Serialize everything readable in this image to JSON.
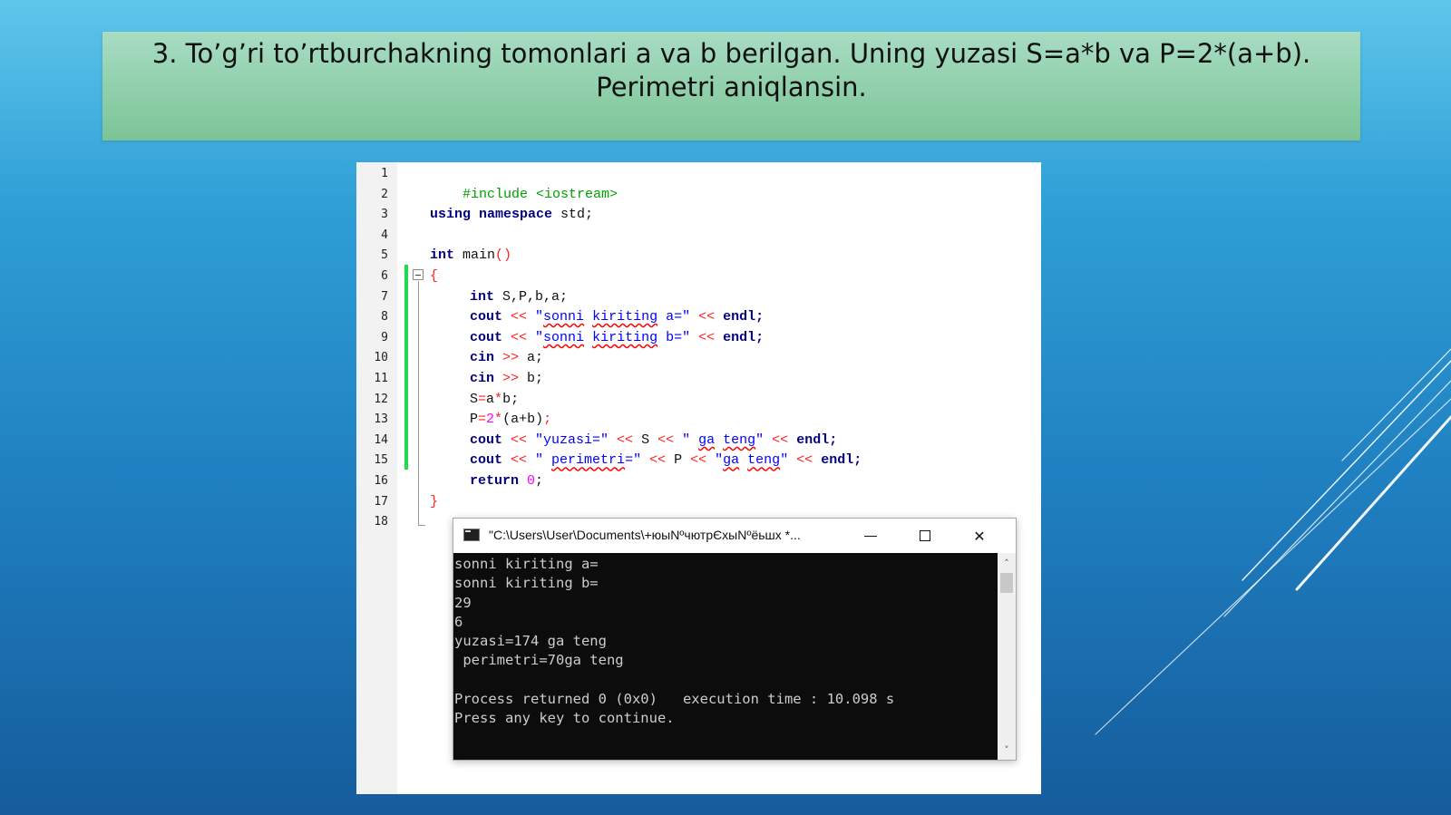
{
  "slide": {
    "title_line1": "3.   To’g’ri to’rtburchakning tomonlari   a va b  berilgan. Uning yuzasi S=a*b  va  P=2*(a+b).",
    "title_line2": "Perimetri aniqlansin."
  },
  "editor": {
    "line_numbers": [
      "1",
      "2",
      "3",
      "4",
      "5",
      "6",
      "7",
      "8",
      "9",
      "10",
      "11",
      "12",
      "13",
      "14",
      "15",
      "16",
      "17",
      "18"
    ],
    "lines": {
      "l1": "#include <iostream>",
      "l3_kw": "using namespace",
      "l3_rest": " std;",
      "l5_kw": "int",
      "l5_rest": " main",
      "l5_paren": "()",
      "l6": "{",
      "l7_kw": "int",
      "l7_rest": " S,P,b,a;",
      "l8_cout": "cout",
      "l8_op1": " << ",
      "l8_q1": "\"",
      "l8_w1": "sonni",
      "l8_sp": " ",
      "l8_w2": "kiriting",
      "l8_tail": " a=\"",
      "l8_op2": " << ",
      "l8_endl": "endl;",
      "l9_cout": "cout",
      "l9_op1": " << ",
      "l9_q1": "\"",
      "l9_w1": "sonni",
      "l9_sp": " ",
      "l9_w2": "kiriting",
      "l9_tail": " b=\"",
      "l9_op2": " << ",
      "l9_endl": "endl;",
      "l10_cin": "cin",
      "l10_op": " >> ",
      "l10_var": "a;",
      "l11_cin": "cin",
      "l11_op": " >> ",
      "l11_var": "b;",
      "l12_a": "S",
      "l12_op1": "=",
      "l12_b": "a",
      "l12_op2": "*",
      "l12_c": "b;",
      "l13_a": "P",
      "l13_op1": "=",
      "l13_num": "2",
      "l13_op2": "*",
      "l13_paren": "(a+b)",
      "l13_semi": ";",
      "l14_cout": "cout",
      "l14_op1": " << ",
      "l14_s1": "\"yuzasi=\"",
      "l14_op2": " << ",
      "l14_var": "S",
      "l14_op3": " << ",
      "l14_q": "\" ",
      "l14_w1": "ga",
      "l14_sp": " ",
      "l14_w2": "teng",
      "l14_q2": "\"",
      "l14_op4": " << ",
      "l14_endl": "endl;",
      "l15_cout": "cout",
      "l15_op1": " << ",
      "l15_q1": "\" ",
      "l15_w1": "perimetri",
      "l15_q2": "=\"",
      "l15_op2": " << ",
      "l15_var": "P",
      "l15_op3": " << ",
      "l15_q3": "\"",
      "l15_w2": "ga",
      "l15_sp": " ",
      "l15_w3": "teng",
      "l15_q4": "\"",
      "l15_op4": " << ",
      "l15_endl": "endl;",
      "l16_kw": "return",
      "l16_sp": " ",
      "l16_num": "0",
      "l16_semi": ";",
      "l17": "}"
    }
  },
  "console": {
    "title": "\"C:\\Users\\User\\Documents\\+юыNºчютрЄхыNºёьшх *...",
    "output": "sonni kiriting a=\nsonni kiriting b=\n29\n6\nyuzasi=174 ga teng\n perimetri=70ga teng\n\nProcess returned 0 (0x0)   execution time : 10.098 s\nPress any key to continue.",
    "icons": {
      "app": "console-app-icon",
      "minimize": "minimize-icon",
      "maximize": "maximize-icon",
      "close": "close-icon",
      "scroll_up": "chevron-up-icon",
      "scroll_down": "chevron-down-icon"
    },
    "close_glyph": "✕",
    "up_glyph": "˄",
    "down_glyph": "˅"
  }
}
